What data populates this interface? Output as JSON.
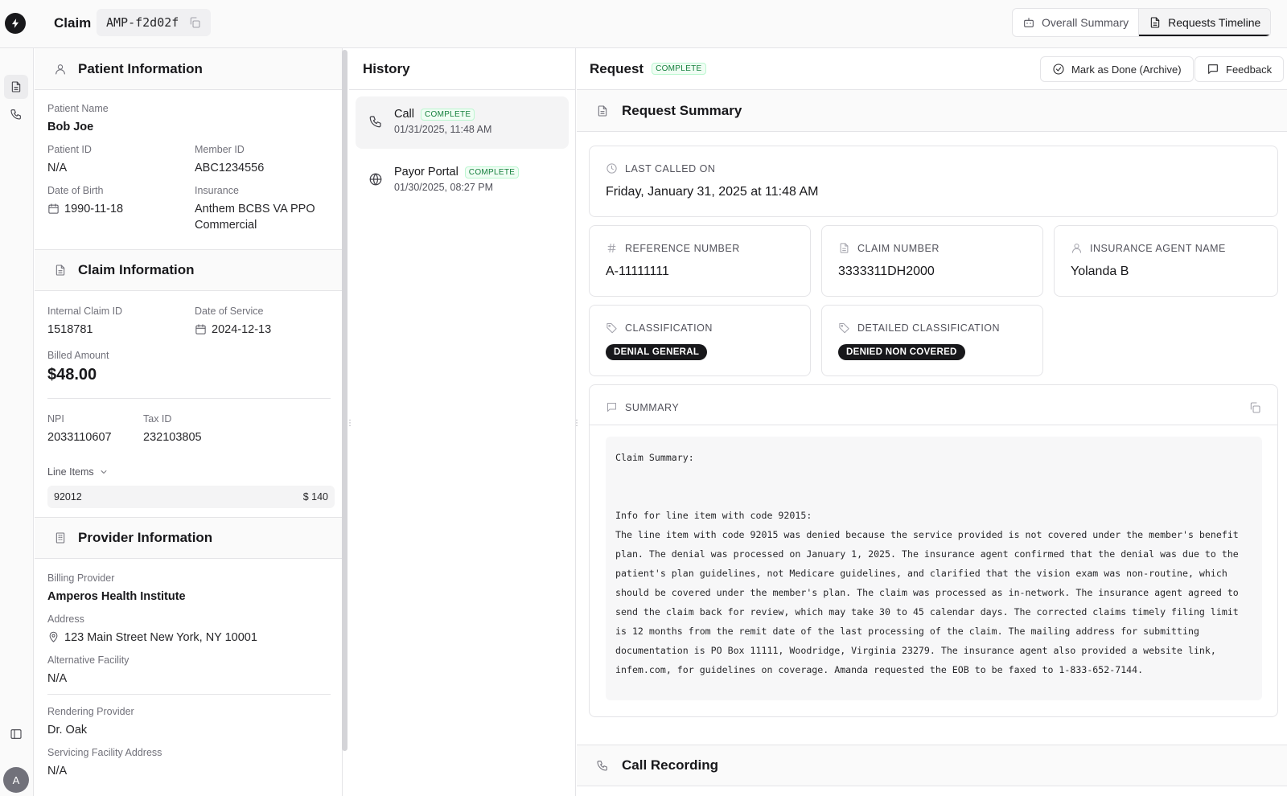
{
  "topbar": {
    "claim_label": "Claim",
    "claim_id": "AMP-f2d02f",
    "views": [
      {
        "label": "Overall Summary",
        "icon": "robot-icon",
        "active": false
      },
      {
        "label": "Requests Timeline",
        "icon": "document-icon",
        "active": true
      }
    ]
  },
  "rail": {
    "items": [
      {
        "icon": "document-icon",
        "active": true
      },
      {
        "icon": "phone-icon",
        "active": false
      }
    ],
    "avatar_initial": "A"
  },
  "patient": {
    "section_title": "Patient Information",
    "name_label": "Patient Name",
    "name": "Bob Joe",
    "patient_id_label": "Patient ID",
    "patient_id": "N/A",
    "member_id_label": "Member ID",
    "member_id": "ABC1234556",
    "dob_label": "Date of Birth",
    "dob": "1990-11-18",
    "insurance_label": "Insurance",
    "insurance": "Anthem BCBS VA PPO Commercial"
  },
  "claim": {
    "section_title": "Claim Information",
    "internal_id_label": "Internal Claim ID",
    "internal_id": "1518781",
    "dos_label": "Date of Service",
    "dos": "2024-12-13",
    "billed_label": "Billed Amount",
    "billed": "$48.00",
    "npi_label": "NPI",
    "npi": "2033110607",
    "tax_label": "Tax ID",
    "tax": "232103805",
    "line_items_label": "Line Items",
    "line_items": [
      {
        "code": "92012",
        "amount": "$ 140"
      }
    ]
  },
  "provider": {
    "section_title": "Provider Information",
    "billing_label": "Billing Provider",
    "billing": "Amperos Health Institute",
    "address_label": "Address",
    "address": "123 Main Street New York, NY 10001",
    "alt_label": "Alternative Facility",
    "alt": "N/A",
    "rendering_label": "Rendering Provider",
    "rendering": "Dr. Oak",
    "servicing_label": "Servicing Facility Address",
    "servicing": "N/A"
  },
  "history": {
    "title": "History",
    "items": [
      {
        "type": "Call",
        "status": "COMPLETE",
        "date": "01/31/2025, 11:48 AM",
        "icon": "phone-icon"
      },
      {
        "type": "Payor Portal",
        "status": "COMPLETE",
        "date": "01/30/2025, 08:27 PM",
        "icon": "globe-icon"
      }
    ]
  },
  "request": {
    "title": "Request",
    "status": "COMPLETE",
    "mark_done_label": "Mark as Done (Archive)",
    "feedback_label": "Feedback",
    "summary_section_title": "Request Summary",
    "last_called_label": "Last Called On",
    "last_called": "Friday, January 31, 2025 at 11:48 AM",
    "reference_label": "Reference Number",
    "reference": "A-11111111",
    "claim_number_label": "Claim Number",
    "claim_number": "3333311DH2000",
    "agent_label": "Insurance Agent Name",
    "agent": "Yolanda B",
    "classification_label": "Classification",
    "classification": "DENIAL GENERAL",
    "detailed_label": "Detailed Classification",
    "detailed": "DENIED NON COVERED",
    "summary_label": "Summary",
    "summary_text": "Claim Summary:\n\n\nInfo for line item with code 92015:\nThe line item with code 92015 was denied because the service provided is not covered under the member's benefit plan. The denial was processed on January 1, 2025. The insurance agent confirmed that the denial was due to the patient's plan guidelines, not Medicare guidelines, and clarified that the vision exam was non-routine, which should be covered under the member's plan. The claim was processed as in-network. The insurance agent agreed to send the claim back for review, which may take 30 to 45 calendar days. The corrected claims timely filing limit is 12 months from the remit date of the last processing of the claim. The mailing address for submitting documentation is PO Box 11111, Woodridge, Virginia 23279. The insurance agent also provided a website link, infem.com, for guidelines on coverage. Amanda requested the EOB to be faxed to 1-833-652-7144.",
    "recording_title": "Call Recording"
  },
  "colors": {
    "accent": "#18181b",
    "complete_green": "#15803d",
    "border": "#e4e4e7"
  }
}
